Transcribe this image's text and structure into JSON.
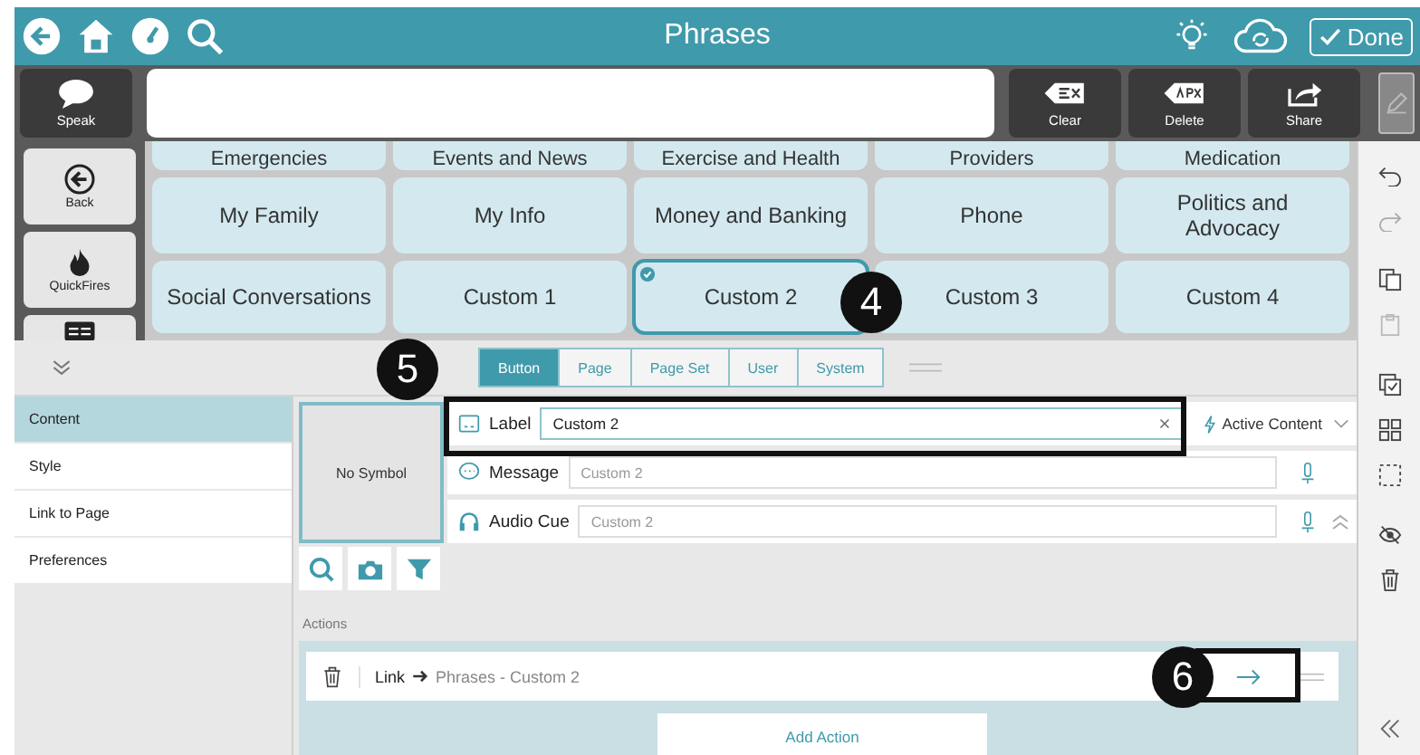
{
  "top_bar": {
    "title": "Phrases",
    "done_label": "Done"
  },
  "message_bar": {
    "speak_label": "Speak",
    "buttons": [
      {
        "label": "Clear",
        "kind": "clear"
      },
      {
        "label": "Delete",
        "kind": "delete"
      },
      {
        "label": "Share",
        "kind": "share"
      }
    ]
  },
  "left_nav": [
    {
      "label": "Back",
      "kind": "back"
    },
    {
      "label": "QuickFires",
      "kind": "fire"
    },
    {
      "kind": "keyboard"
    }
  ],
  "grid": [
    [
      {
        "label": "Emergencies",
        "selected": false
      },
      {
        "label": "Events and News",
        "selected": false
      },
      {
        "label": "Exercise and Health",
        "selected": false
      },
      {
        "label": "Providers",
        "selected": false
      },
      {
        "label": "Medication",
        "selected": false
      }
    ],
    [
      {
        "label": "My Family",
        "selected": false
      },
      {
        "label": "My Info",
        "selected": false
      },
      {
        "label": "Money and Banking",
        "selected": false
      },
      {
        "label": "Phone",
        "selected": false
      },
      {
        "label": "Politics and Advocacy",
        "selected": false
      }
    ],
    [
      {
        "label": "Social Conversations",
        "selected": false
      },
      {
        "label": "Custom 1",
        "selected": false
      },
      {
        "label": "Custom 2",
        "selected": true
      },
      {
        "label": "Custom 3",
        "selected": false
      },
      {
        "label": "Custom 4",
        "selected": false
      }
    ]
  ],
  "editor_tabs": [
    {
      "label": "Button",
      "selected": true
    },
    {
      "label": "Page",
      "selected": false
    },
    {
      "label": "Page Set",
      "selected": false
    },
    {
      "label": "User",
      "selected": false
    },
    {
      "label": "System",
      "selected": false
    }
  ],
  "sidebar": [
    {
      "label": "Content",
      "selected": true
    },
    {
      "label": "Style",
      "selected": false
    },
    {
      "label": "Link to Page",
      "selected": false
    },
    {
      "label": "Preferences",
      "selected": false
    }
  ],
  "symbol": {
    "text": "No Symbol"
  },
  "fields": {
    "label": {
      "label": "Label",
      "value": "Custom 2"
    },
    "message": {
      "label": "Message",
      "placeholder": "Custom 2"
    },
    "audio_cue": {
      "label": "Audio Cue",
      "placeholder": "Custom 2"
    }
  },
  "active_content": "Active Content",
  "actions_heading": "Actions",
  "actions": [
    {
      "type": "Link",
      "target": "Phrases - Custom 2"
    }
  ],
  "add_action": "Add Action",
  "callouts": [
    "4",
    "5",
    "6"
  ]
}
